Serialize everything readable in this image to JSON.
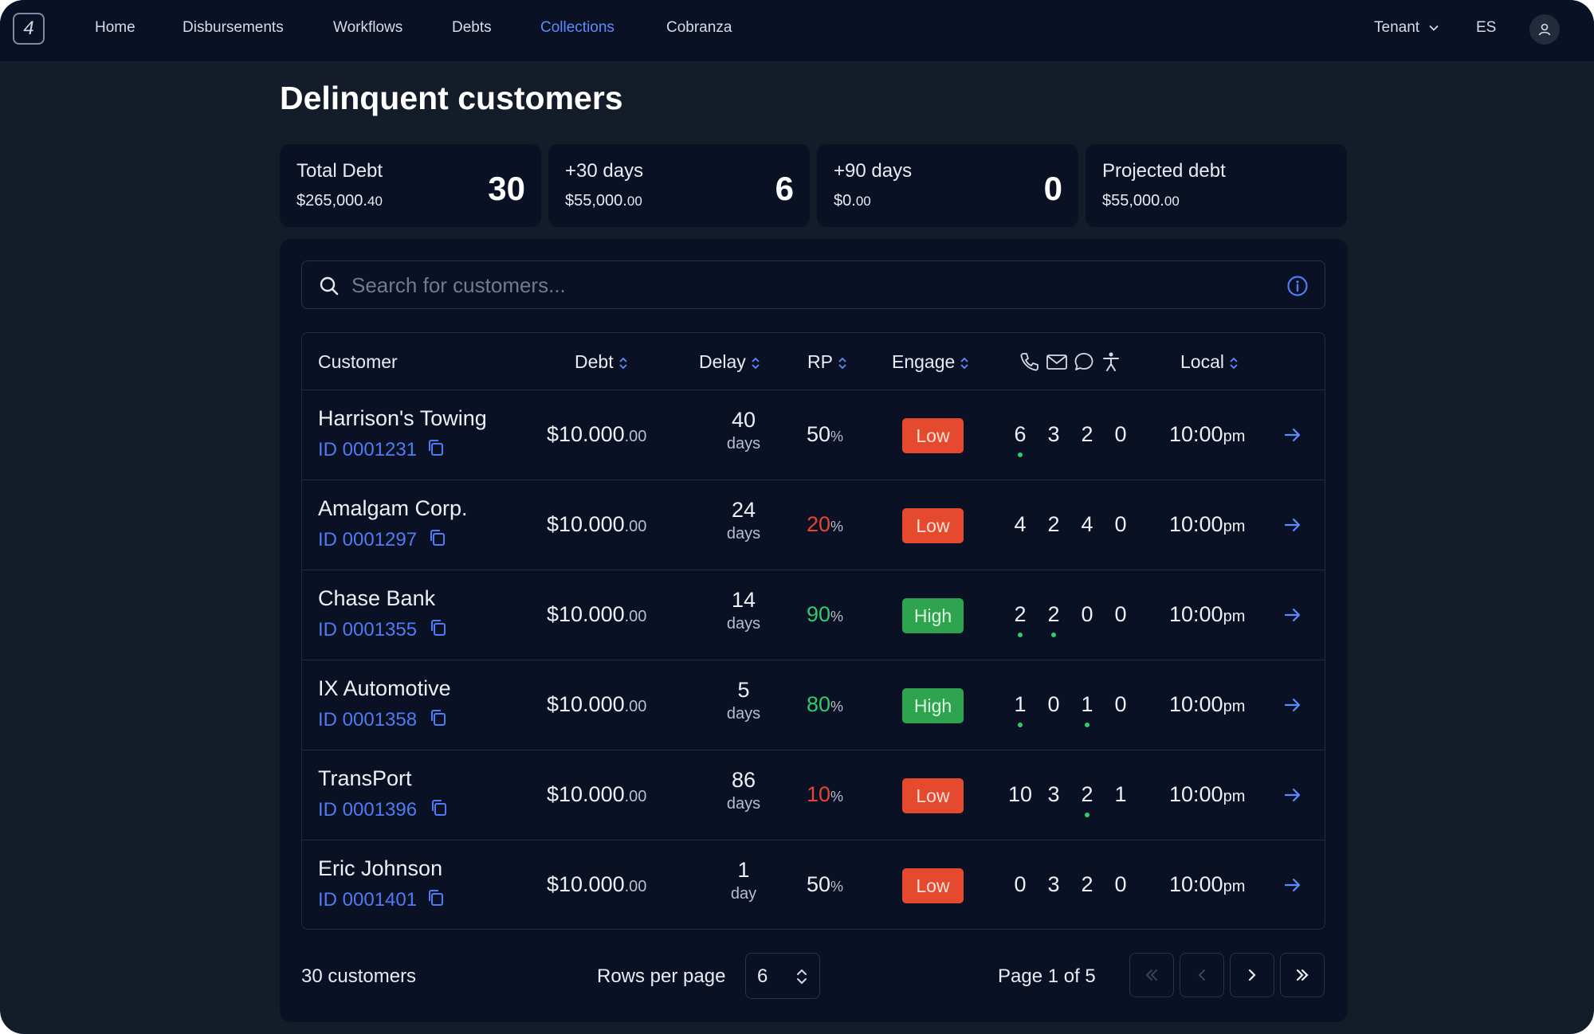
{
  "nav": {
    "logo": "4",
    "links": [
      "Home",
      "Disbursements",
      "Workflows",
      "Debts",
      "Collections",
      "Cobranza"
    ],
    "active": "Collections",
    "tenant": "Tenant",
    "language": "ES"
  },
  "page": {
    "title": "Delinquent customers"
  },
  "cards": [
    {
      "label": "Total Debt",
      "amount": "$265,000.",
      "cents": "40",
      "count": "30"
    },
    {
      "label": "+30 days",
      "amount": "$55,000.",
      "cents": "00",
      "count": "6"
    },
    {
      "label": "+90 days",
      "amount": "$0.",
      "cents": "00",
      "count": "0"
    },
    {
      "label": "Projected debt",
      "amount": "$55,000.",
      "cents": "00",
      "count": ""
    }
  ],
  "search": {
    "placeholder": "Search for customers..."
  },
  "table": {
    "headers": {
      "customer": "Customer",
      "debt": "Debt",
      "delay": "Delay",
      "rp": "RP",
      "engage": "Engage",
      "local": "Local"
    },
    "rows": [
      {
        "name": "Harrison's Towing",
        "id": "ID 0001231",
        "debt": "$10.000",
        "debt_cents": ".00",
        "delay": "40",
        "delay_unit": "days",
        "rp": "50",
        "rp_color": "#eef0f5",
        "engage": "Low",
        "calls": "6",
        "emails": "3",
        "chats": "2",
        "visits": "0",
        "local": "10:00",
        "local_suffix": "pm"
      },
      {
        "name": "Amalgam Corp.",
        "id": "ID 0001297",
        "debt": "$10.000",
        "debt_cents": ".00",
        "delay": "24",
        "delay_unit": "days",
        "rp": "20",
        "rp_color": "#e5452c",
        "engage": "Low",
        "calls": "4",
        "emails": "2",
        "chats": "4",
        "visits": "0",
        "local": "10:00",
        "local_suffix": "pm"
      },
      {
        "name": "Chase Bank",
        "id": "ID 0001355",
        "debt": "$10.000",
        "debt_cents": ".00",
        "delay": "14",
        "delay_unit": "days",
        "rp": "90",
        "rp_color": "#2ecc6b",
        "engage": "High",
        "calls": "2",
        "emails": "2",
        "chats": "0",
        "visits": "0",
        "local": "10:00",
        "local_suffix": "pm"
      },
      {
        "name": "IX Automotive",
        "id": "ID 0001358",
        "debt": "$10.000",
        "debt_cents": ".00",
        "delay": "5",
        "delay_unit": "days",
        "rp": "80",
        "rp_color": "#2ecc6b",
        "engage": "High",
        "calls": "1",
        "emails": "0",
        "chats": "1",
        "visits": "0",
        "local": "10:00",
        "local_suffix": "pm"
      },
      {
        "name": "TransPort",
        "id": "ID 0001396",
        "debt": "$10.000",
        "debt_cents": ".00",
        "delay": "86",
        "delay_unit": "days",
        "rp": "10",
        "rp_color": "#e5452c",
        "engage": "Low",
        "calls": "10",
        "emails": "3",
        "chats": "2",
        "visits": "1",
        "local": "10:00",
        "local_suffix": "pm"
      },
      {
        "name": "Eric Johnson",
        "id": "ID 0001401",
        "debt": "$10.000",
        "debt_cents": ".00",
        "delay": "1",
        "delay_unit": "day",
        "rp": "50",
        "rp_color": "#eef0f5",
        "engage": "Low",
        "calls": "0",
        "emails": "3",
        "chats": "2",
        "visits": "0",
        "local": "10:00",
        "local_suffix": "pm"
      }
    ],
    "percent_sign": "%"
  },
  "footer": {
    "count": "30 customers",
    "rows_per_page_label": "Rows per page",
    "rows_per_page": "6",
    "page_info": "Page 1 of 5"
  },
  "colors": {
    "accent": "#5b8cff",
    "low": "#e54a2e",
    "high": "#2ea44f",
    "indicator": "#2ecc6b"
  }
}
